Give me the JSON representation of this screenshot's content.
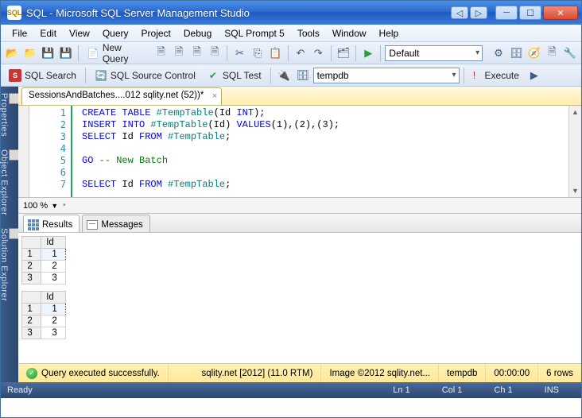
{
  "window": {
    "title": "SQL - Microsoft SQL Server Management Studio"
  },
  "menus": [
    "File",
    "Edit",
    "View",
    "Query",
    "Project",
    "Debug",
    "SQL Prompt 5",
    "Tools",
    "Window",
    "Help"
  ],
  "toolbar1": {
    "newquery": "New Query",
    "default_combo": "Default"
  },
  "toolbar2": {
    "sql_search": "SQL Search",
    "sql_source": "SQL Source Control",
    "sql_test": "SQL Test",
    "db_combo": "tempdb",
    "execute": "Execute"
  },
  "sidebar": [
    "Properties",
    "Object Explorer",
    "Solution Explorer"
  ],
  "tab": {
    "label": "SessionsAndBatches....012 sqlity.net (52))*"
  },
  "code": {
    "lines": [
      "1",
      "2",
      "3",
      "4",
      "5",
      "6",
      "7"
    ],
    "l1": {
      "a": "CREATE",
      "b": " TABLE",
      "c": " #TempTable",
      "d": "(",
      "e": "Id",
      "f": " INT",
      "g": ");"
    },
    "l2": {
      "a": "INSERT",
      "b": " INTO",
      "c": " #TempTable",
      "d": "(",
      "e": "Id",
      "f": ")",
      "g": " VALUES",
      "h": "(1),(2),(3);"
    },
    "l3": {
      "a": "SELECT",
      "b": " Id",
      "c": " FROM",
      "d": " #TempTable",
      "e": ";"
    },
    "l5": {
      "a": "GO",
      "b": " -- New Batch"
    },
    "l7": {
      "a": "SELECT",
      "b": " Id",
      "c": " FROM",
      "d": " #TempTable",
      "e": ";"
    }
  },
  "zoom": "100 %",
  "results": {
    "tabs": {
      "results": "Results",
      "messages": "Messages"
    },
    "col": "Id",
    "set1": [
      {
        "n": "1",
        "v": "1"
      },
      {
        "n": "2",
        "v": "2"
      },
      {
        "n": "3",
        "v": "3"
      }
    ],
    "set2": [
      {
        "n": "1",
        "v": "1"
      },
      {
        "n": "2",
        "v": "2"
      },
      {
        "n": "3",
        "v": "3"
      }
    ]
  },
  "querystatus": {
    "msg": "Query executed successfully.",
    "server": "sqlity.net [2012] (11.0 RTM)",
    "user": "Image ©2012 sqlity.net...",
    "db": "tempdb",
    "time": "00:00:00",
    "rows": "6 rows"
  },
  "statusbar": {
    "ready": "Ready",
    "ln": "Ln 1",
    "col": "Col 1",
    "ch": "Ch 1",
    "ins": "INS"
  }
}
